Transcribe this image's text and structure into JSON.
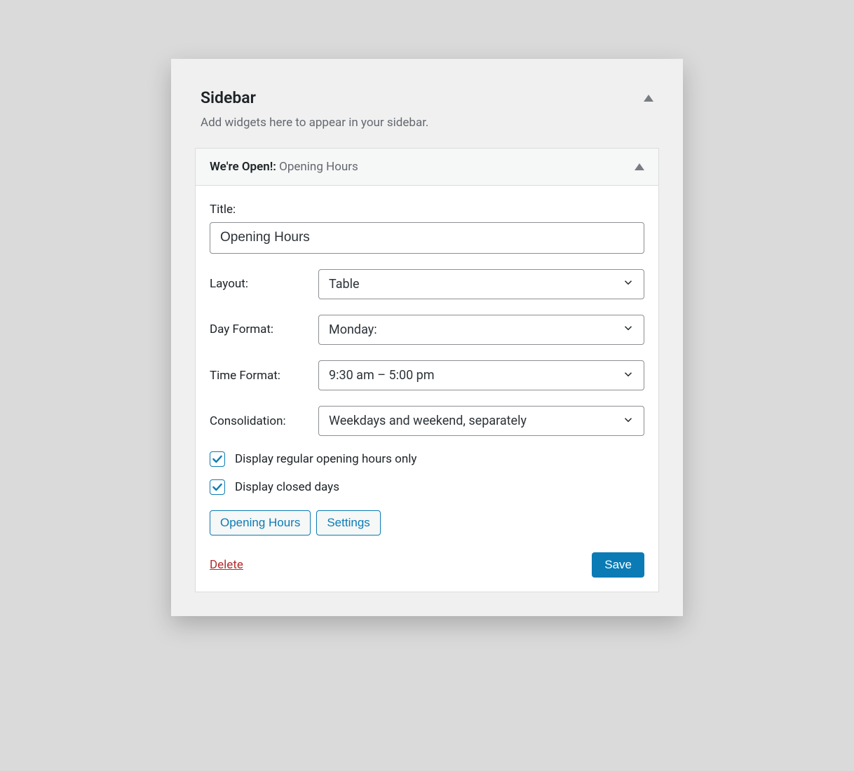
{
  "sidebar": {
    "title": "Sidebar",
    "description": "Add widgets here to appear in your sidebar."
  },
  "widget": {
    "name": "We're Open!",
    "subtitle": "Opening Hours",
    "fields": {
      "title_label": "Title:",
      "title_value": "Opening Hours",
      "layout_label": "Layout:",
      "layout_value": "Table",
      "day_format_label": "Day Format:",
      "day_format_value": "Monday:",
      "time_format_label": "Time Format:",
      "time_format_value": "9:30 am – 5:00 pm",
      "consolidation_label": "Consolidation:",
      "consolidation_value": "Weekdays and weekend, separately"
    },
    "checkboxes": {
      "regular_only_label": "Display regular opening hours only",
      "regular_only_checked": true,
      "closed_days_label": "Display closed days",
      "closed_days_checked": true
    },
    "buttons": {
      "opening_hours_label": "Opening Hours",
      "settings_label": "Settings"
    },
    "footer": {
      "delete_label": "Delete",
      "save_label": "Save"
    }
  }
}
